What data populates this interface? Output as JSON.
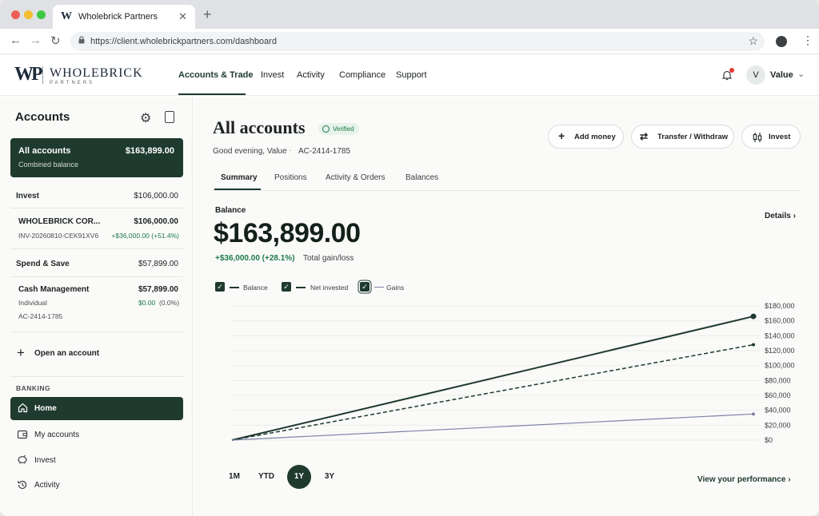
{
  "browser": {
    "tab_title": "Wholebrick Partners",
    "favicon": "W",
    "url": "https://client.wholebrickpartners.com/dashboard"
  },
  "header": {
    "logo_mark": "WP",
    "logo_name": "WHOLEBRICK",
    "logo_sub": "PARTNERS",
    "nav": [
      "Accounts & Trade",
      "Invest",
      "Activity",
      "Compliance",
      "Support"
    ],
    "active_nav": "Accounts & Trade",
    "avatar_initial": "V",
    "user_name": "Value",
    "notification_dot_color": "#e53935"
  },
  "sidebar": {
    "title": "Accounts",
    "all_accounts": {
      "label": "All accounts",
      "sub": "Combined balance",
      "amount": "$163,899.00"
    },
    "invest": {
      "label": "Invest",
      "amount": "$106,000.00",
      "account": {
        "name": "WHOLEBRICK COR...",
        "amount": "$106,000.00",
        "id": "INV-20260810-CEK91XV6",
        "gain": "+$36,000.00 (+51.4%)"
      }
    },
    "spend_save": {
      "label": "Spend & Save",
      "amount": "$57,899.00",
      "account": {
        "name": "Cash Management",
        "amount": "$57,899.00",
        "type": "Individual",
        "gain_value": "$0.00",
        "gain_pct": "(0.0%)",
        "id": "AC-2414-1785"
      }
    },
    "open_account": "Open an account",
    "banking_header": "BANKING",
    "banking_items": [
      "Home",
      "My accounts",
      "Invest",
      "Activity"
    ],
    "active_banking": "Home"
  },
  "main": {
    "title": "All accounts",
    "verified": "Verified",
    "greeting": "Good evening, Value",
    "account_no": "AC-2414-1785",
    "actions": [
      "Add money",
      "Transfer / Withdraw",
      "Invest"
    ],
    "tabs": [
      "Summary",
      "Positions",
      "Activity & Orders",
      "Balances"
    ],
    "active_tab": "Summary",
    "balance_label": "Balance",
    "balance": "$163,899.00",
    "gain": "+$36,000.00 (+28.1%)",
    "gain_label": "Total gain/loss",
    "details": "Details",
    "legend": [
      "Balance",
      "Net invested",
      "Gains"
    ],
    "ranges": [
      "1M",
      "YTD",
      "1Y",
      "3Y"
    ],
    "active_range": "1Y",
    "view_performance": "View your performance"
  },
  "chart_data": {
    "type": "line",
    "y_ticks": [
      "$180,000",
      "$160,000",
      "$140,000",
      "$120,000",
      "$100,000",
      "$80,000",
      "$60,000",
      "$40,000",
      "$20,000",
      "$0"
    ],
    "ylim": [
      0,
      180000
    ],
    "x_points": 2,
    "series": [
      {
        "name": "Balance",
        "style": "solid",
        "color": "#1f3a2f",
        "values": [
          0,
          166000
        ]
      },
      {
        "name": "Net invested",
        "style": "dashed",
        "color": "#1f3a2f",
        "values": [
          0,
          128000
        ]
      },
      {
        "name": "Gains",
        "style": "thin",
        "color": "#7c82a3",
        "values": [
          0,
          35000
        ]
      }
    ],
    "grid": true,
    "legend_position": "top-left"
  }
}
